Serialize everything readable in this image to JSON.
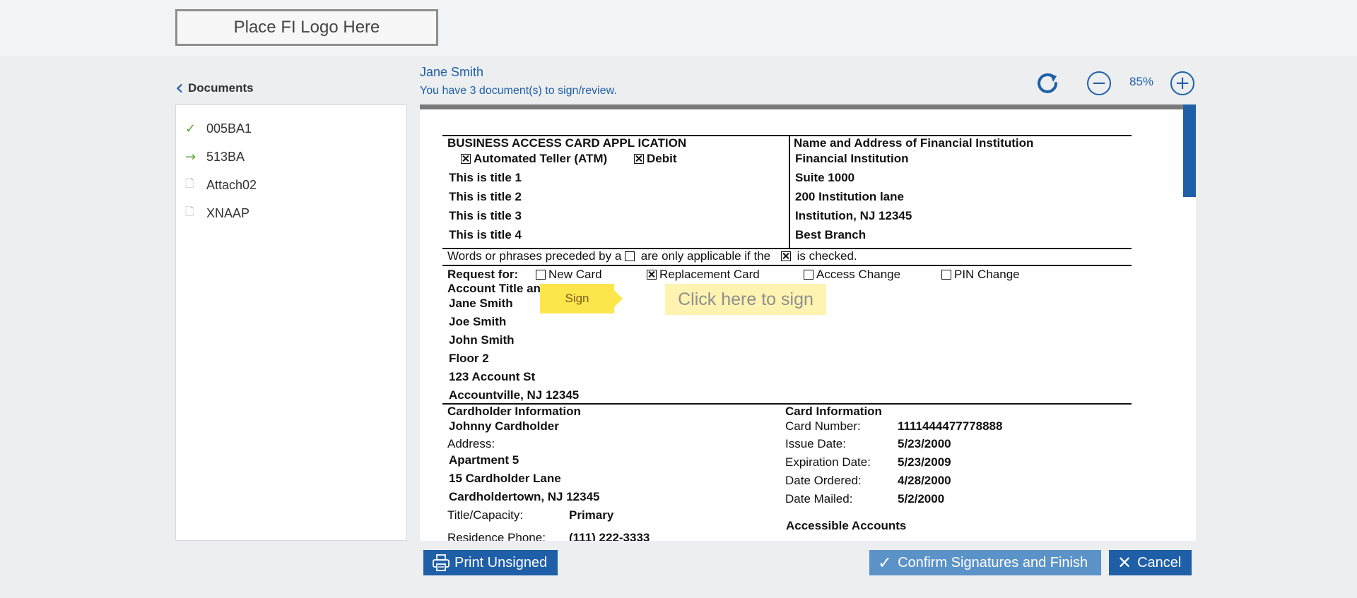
{
  "header": {
    "logo_text": "Place FI Logo Here"
  },
  "sidebar": {
    "back_icon": "chevron-left-icon",
    "title": "Documents",
    "items": [
      {
        "label": "005BA1",
        "status": "signed",
        "icon": "check-icon"
      },
      {
        "label": "513BA",
        "status": "current",
        "icon": "arrow-right-icon"
      },
      {
        "label": "Attach02",
        "status": "pending",
        "icon": "file-icon"
      },
      {
        "label": "XNAAP",
        "status": "pending",
        "icon": "file-icon"
      }
    ]
  },
  "info": {
    "user_name": "Jane Smith",
    "message": "You have 3 document(s) to sign/review."
  },
  "toolbar": {
    "refresh_icon": "refresh-icon",
    "zoom_out": "−",
    "zoom_level": "85%",
    "zoom_in": "+"
  },
  "document": {
    "app_title": "BUSINESS ACCESS CARD APPL ICATION",
    "atm_label": "Automated Teller (ATM)",
    "debit_label": "Debit",
    "titles": [
      "This is title 1",
      "This is title 2",
      "This is title 3",
      "This is title 4"
    ],
    "fi_header": "Name and Address of Financial Institution",
    "fi_lines": [
      "Financial Institution",
      "Suite 1000",
      "200 Institution lane",
      "Institution, NJ 12345",
      "Best Branch"
    ],
    "words_note_1": "Words or phrases preceded by a",
    "words_note_2": "are only applicable if the",
    "words_note_3": "is checked.",
    "request_label": "Request for:",
    "request_options": [
      {
        "label": "New Card",
        "checked": false
      },
      {
        "label": "Replacement Card",
        "checked": true
      },
      {
        "label": "Access Change",
        "checked": false
      },
      {
        "label": "PIN Change",
        "checked": false
      }
    ],
    "account_title": "Account Title an",
    "account_lines": [
      "Jane Smith",
      "Joe Smith",
      "John Smith",
      "Floor 2",
      "123 Account St",
      "Accountville, NJ 12345"
    ],
    "cardholder_header": "Cardholder Information",
    "cardholder_name": "Johnny Cardholder",
    "address_label": "Address:",
    "address_lines": [
      "Apartment 5",
      "15 Cardholder Lane",
      "Cardholdertown, NJ 12345"
    ],
    "title_capacity_label": "Title/Capacity:",
    "title_capacity_value": "Primary",
    "residence_label": "Residence Phone:",
    "residence_value": "(111) 222-3333",
    "card_info_header": "Card Information",
    "card_rows": [
      {
        "label": "Card Number:",
        "value": "1111444477778888"
      },
      {
        "label": "Issue Date:",
        "value": "5/23/2000"
      },
      {
        "label": "Expiration Date:",
        "value": "5/23/2009"
      },
      {
        "label": "Date Ordered:",
        "value": "4/28/2000"
      },
      {
        "label": "Date Mailed:",
        "value": "5/2/2000"
      }
    ],
    "accessible_accounts": "Accessible Accounts",
    "sign_tag": "Sign",
    "sign_field": "Click here to sign"
  },
  "footer": {
    "print_label": "Print Unsigned",
    "confirm_label": "Confirm Signatures and Finish",
    "cancel_label": "Cancel"
  },
  "colors": {
    "accent": "#1f5fa8",
    "sign_tag": "#fde64b",
    "sign_field": "#fef3b0",
    "confirm": "#5b92c8"
  }
}
